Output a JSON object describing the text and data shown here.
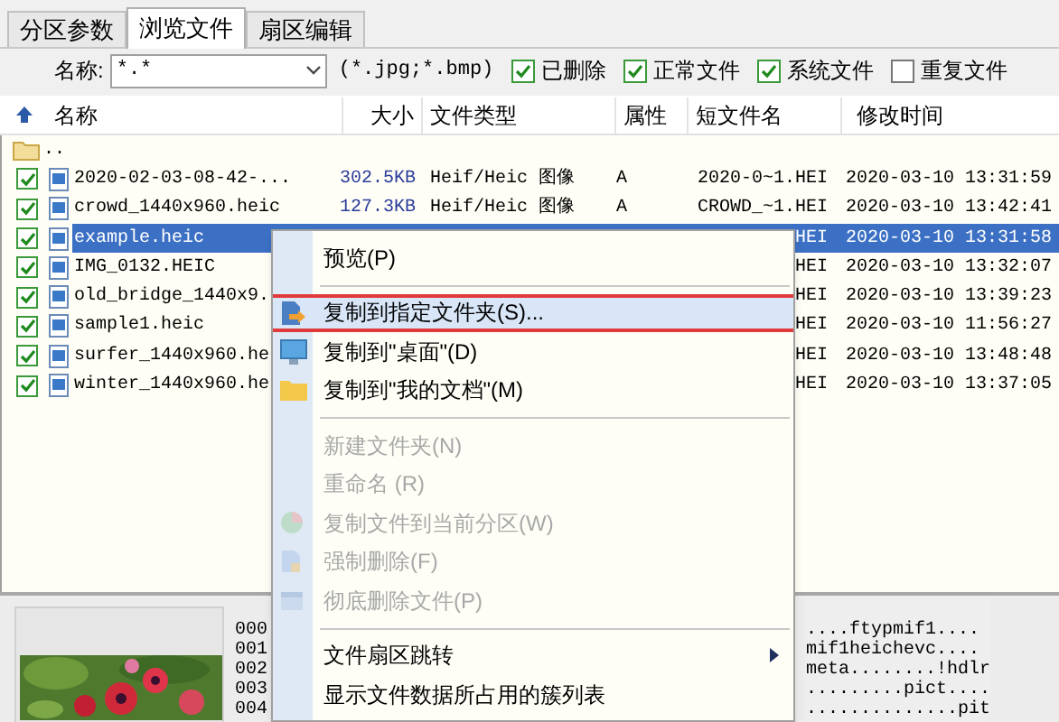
{
  "tabs": [
    {
      "label": "分区参数",
      "selected": false
    },
    {
      "label": "浏览文件",
      "selected": true
    },
    {
      "label": "扇区编辑",
      "selected": false
    }
  ],
  "filter": {
    "label": "名称:",
    "value": "*.*",
    "hint": "(*.jpg;*.bmp)",
    "checkboxes": [
      {
        "label": "已删除",
        "checked": true
      },
      {
        "label": "正常文件",
        "checked": true
      },
      {
        "label": "系统文件",
        "checked": true
      },
      {
        "label": "重复文件",
        "checked": false
      }
    ]
  },
  "file_list": {
    "columns": [
      "名称",
      "大小",
      "文件类型",
      "属性",
      "短文件名",
      "修改时间"
    ],
    "rows": [
      {
        "kind": "parent",
        "name": ".."
      },
      {
        "kind": "file",
        "checked": true,
        "selected": false,
        "name": "2020-02-03-08-42-...",
        "size": "302.5KB",
        "type": "Heif/Heic 图像",
        "attr": "A",
        "short_name": "2020-0~1.HEI",
        "modified": "2020-03-10 13:31:59"
      },
      {
        "kind": "file",
        "checked": true,
        "selected": false,
        "name": "crowd_1440x960.heic",
        "size": "127.3KB",
        "type": "Heif/Heic 图像",
        "attr": "A",
        "short_name": "CROWD_~1.HEI",
        "modified": "2020-03-10 13:42:41"
      },
      {
        "kind": "file",
        "checked": true,
        "selected": true,
        "name": "example.heic",
        "short_name": "HEI",
        "modified": "2020-03-10 13:31:58"
      },
      {
        "kind": "file",
        "checked": true,
        "selected": false,
        "name": "IMG_0132.HEIC",
        "short_name": "HEI",
        "modified": "2020-03-10 13:32:07"
      },
      {
        "kind": "file",
        "checked": true,
        "selected": false,
        "name": "old_bridge_1440x9.",
        "short_name": "HEI",
        "modified": "2020-03-10 13:39:23"
      },
      {
        "kind": "file",
        "checked": true,
        "selected": false,
        "name": "sample1.heic",
        "short_name": "HEI",
        "modified": "2020-03-10 11:56:27"
      },
      {
        "kind": "file",
        "checked": true,
        "selected": false,
        "name": "surfer_1440x960.he",
        "short_name": "HEI",
        "modified": "2020-03-10 13:48:48"
      },
      {
        "kind": "file",
        "checked": true,
        "selected": false,
        "name": "winter_1440x960.he",
        "short_name": "HEI",
        "modified": "2020-03-10 13:37:05"
      }
    ]
  },
  "preview": {
    "kind": "picture",
    "offsets": [
      "000",
      "001",
      "002",
      "003",
      "004"
    ],
    "ascii": [
      "....ftypmif1....",
      "mif1heichevc....",
      "meta........!hdlr",
      ".........pict....",
      "..............pit"
    ]
  },
  "context_menu": {
    "items": [
      {
        "kind": "item",
        "label": "预览(P)",
        "disabled": false,
        "highlighted": false
      },
      {
        "kind": "separator"
      },
      {
        "kind": "item",
        "label": "复制到指定文件夹(S)...",
        "disabled": false,
        "highlighted": true
      },
      {
        "kind": "item",
        "label": "复制到\"桌面\"(D)",
        "disabled": false,
        "highlighted": false
      },
      {
        "kind": "item",
        "label": "复制到\"我的文档\"(M)",
        "disabled": false,
        "highlighted": false
      },
      {
        "kind": "separator"
      },
      {
        "kind": "item",
        "label": "新建文件夹(N)",
        "disabled": true,
        "highlighted": false
      },
      {
        "kind": "item",
        "label": "重命名 (R)",
        "disabled": true,
        "highlighted": false
      },
      {
        "kind": "item",
        "label": "复制文件到当前分区(W)",
        "disabled": true,
        "highlighted": false
      },
      {
        "kind": "item",
        "label": "强制删除(F)",
        "disabled": true,
        "highlighted": false
      },
      {
        "kind": "item",
        "label": "彻底删除文件(P)",
        "disabled": true,
        "highlighted": false
      },
      {
        "kind": "separator"
      },
      {
        "kind": "submenu",
        "label": "文件扇区跳转",
        "disabled": false,
        "highlighted": false
      },
      {
        "kind": "item",
        "label": "显示文件数据所占用的簇列表",
        "disabled": false,
        "highlighted": false
      }
    ]
  }
}
